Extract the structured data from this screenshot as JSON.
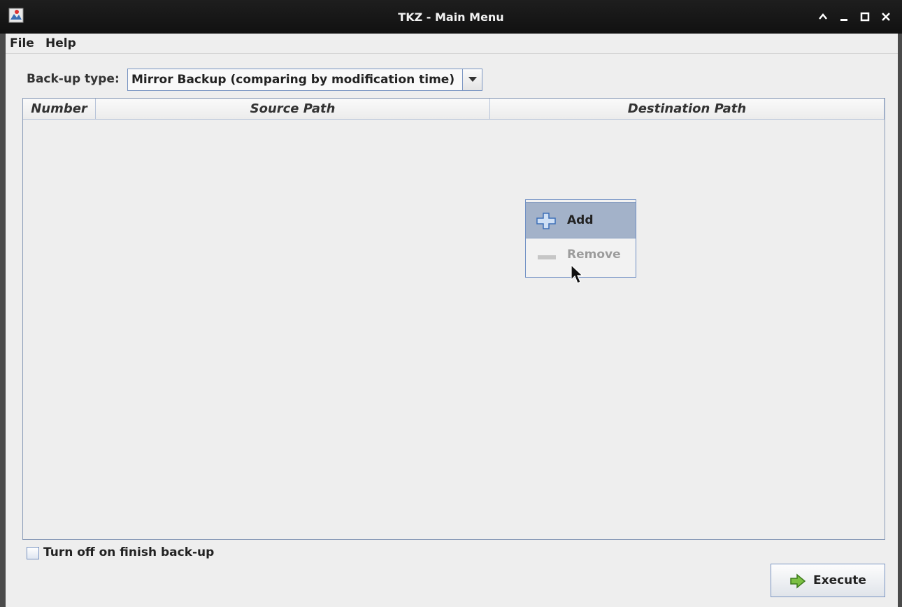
{
  "window": {
    "title": "TKZ - Main Menu",
    "controls": [
      "chevron-up-icon",
      "minimize-icon",
      "maximize-icon",
      "close-icon"
    ]
  },
  "menubar": {
    "items": [
      "File",
      "Help"
    ]
  },
  "backup": {
    "label": "Back-up type:",
    "selected": "Mirror Backup (comparing by modification time)"
  },
  "table": {
    "columns": [
      "Number",
      "Source Path",
      "Destination Path"
    ],
    "rows": []
  },
  "context_menu": {
    "items": [
      {
        "label": "Add",
        "icon": "plus-icon",
        "state": "highlighted"
      },
      {
        "label": "Remove",
        "icon": "minus-icon",
        "state": "disabled"
      }
    ]
  },
  "options": {
    "shutdown_label": "Turn off on finish back-up",
    "shutdown_checked": false
  },
  "actions": {
    "execute_label": "Execute"
  },
  "colors": {
    "accent": "#7a95c2",
    "highlight": "#a3b2c9",
    "titlebar": "#1a1a1a",
    "background": "#eeeeee"
  }
}
